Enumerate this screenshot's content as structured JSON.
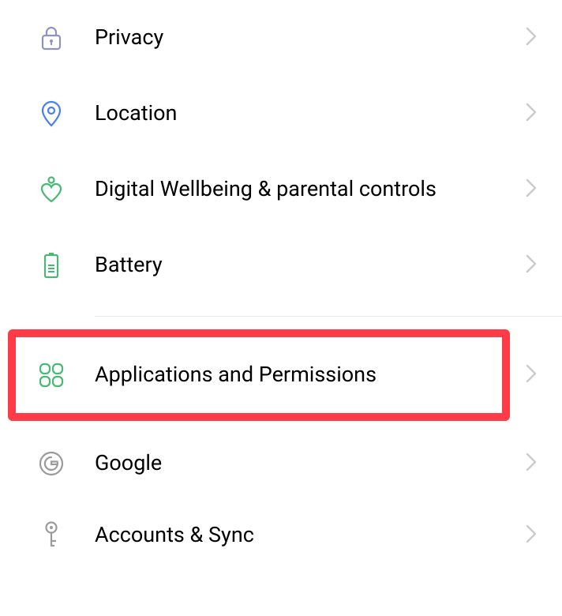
{
  "settings": {
    "group1": [
      {
        "id": "privacy",
        "label": "Privacy",
        "icon": "lock",
        "iconColor": "#8f93bf"
      },
      {
        "id": "location",
        "label": "Location",
        "icon": "location",
        "iconColor": "#4680f5"
      },
      {
        "id": "wellbeing",
        "label": "Digital Wellbeing & parental controls",
        "icon": "heart-person",
        "iconColor": "#49b874"
      },
      {
        "id": "battery",
        "label": "Battery",
        "icon": "battery",
        "iconColor": "#49b874"
      }
    ],
    "group2": [
      {
        "id": "apps",
        "label": "Applications and Permissions",
        "icon": "grid",
        "iconColor": "#49b874",
        "highlighted": true
      },
      {
        "id": "google",
        "label": "Google",
        "icon": "google-g",
        "iconColor": "#9b9b9b"
      },
      {
        "id": "accounts",
        "label": "Accounts & Sync",
        "icon": "key",
        "iconColor": "#9b9b9b"
      }
    ]
  }
}
